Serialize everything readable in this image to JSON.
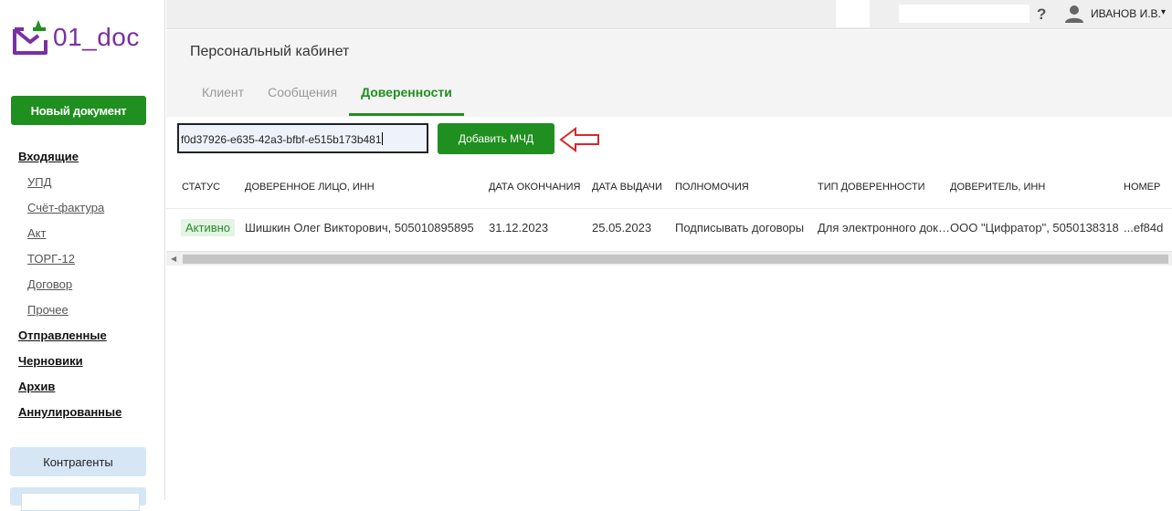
{
  "logo": {
    "text": "01_doc",
    "color": "#7a2fa3"
  },
  "sidebar": {
    "new_document": "Новый документ",
    "items": [
      {
        "label": "Входящие",
        "level": "top"
      },
      {
        "label": "УПД",
        "level": "sub"
      },
      {
        "label": "Счёт-фактура",
        "level": "sub"
      },
      {
        "label": "Акт",
        "level": "sub"
      },
      {
        "label": "ТОРГ-12",
        "level": "sub"
      },
      {
        "label": "Договор",
        "level": "sub"
      },
      {
        "label": "Прочее",
        "level": "sub"
      },
      {
        "label": "Отправленные",
        "level": "top"
      },
      {
        "label": "Черновики",
        "level": "top"
      },
      {
        "label": "Архив",
        "level": "top"
      },
      {
        "label": "Аннулированные",
        "level": "top"
      }
    ],
    "contractors": "Контрагенты"
  },
  "topbar": {
    "help_icon": "?",
    "user_icon": "user-icon",
    "user_name": "ИВАНОВ И.В.",
    "caret": "▾"
  },
  "page": {
    "title": "Персональный кабинет",
    "tabs": [
      {
        "label": "Клиент",
        "active": false
      },
      {
        "label": "Сообщения",
        "active": false
      },
      {
        "label": "Доверенности",
        "active": true
      }
    ]
  },
  "poa": {
    "input_value": "f0d37926-e635-42a3-bfbf-e515b173b481",
    "add_button": "Добавить МЧД",
    "columns": [
      "СТАТУС",
      "ДОВЕРЕННОЕ ЛИЦО, ИНН",
      "ДАТА ОКОНЧАНИЯ",
      "ДАТА ВЫДАЧИ",
      "ПОЛНОМОЧИЯ",
      "ТИП ДОВЕРЕННОСТИ",
      "ДОВЕРИТЕЛЬ, ИНН",
      "НОМЕР"
    ],
    "rows": [
      {
        "status": "Активно",
        "person": "Шишкин Олег Викторович, 505010895895",
        "end_date": "31.12.2023",
        "issue_date": "25.05.2023",
        "powers": "Подписывать договоры",
        "type": "Для электронного документооборота",
        "principal": "ООО \"Цифратор\", 5050138318",
        "number": "...ef84d"
      }
    ]
  },
  "colors": {
    "accent": "#1f8f1f",
    "arrow": "#d9262c",
    "secondary_button": "#d6e6f5"
  }
}
